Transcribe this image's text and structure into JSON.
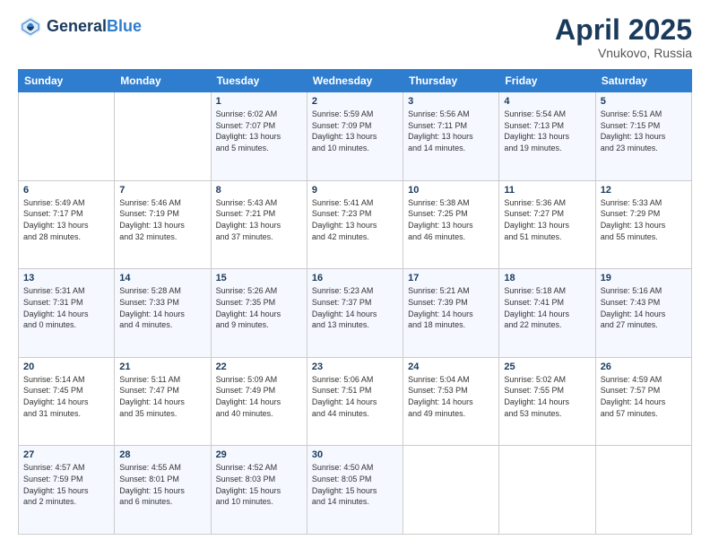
{
  "logo": {
    "line1": "General",
    "line2": "Blue"
  },
  "header": {
    "month": "April 2025",
    "location": "Vnukovo, Russia"
  },
  "weekdays": [
    "Sunday",
    "Monday",
    "Tuesday",
    "Wednesday",
    "Thursday",
    "Friday",
    "Saturday"
  ],
  "weeks": [
    [
      {
        "day": "",
        "info": ""
      },
      {
        "day": "",
        "info": ""
      },
      {
        "day": "1",
        "info": "Sunrise: 6:02 AM\nSunset: 7:07 PM\nDaylight: 13 hours\nand 5 minutes."
      },
      {
        "day": "2",
        "info": "Sunrise: 5:59 AM\nSunset: 7:09 PM\nDaylight: 13 hours\nand 10 minutes."
      },
      {
        "day": "3",
        "info": "Sunrise: 5:56 AM\nSunset: 7:11 PM\nDaylight: 13 hours\nand 14 minutes."
      },
      {
        "day": "4",
        "info": "Sunrise: 5:54 AM\nSunset: 7:13 PM\nDaylight: 13 hours\nand 19 minutes."
      },
      {
        "day": "5",
        "info": "Sunrise: 5:51 AM\nSunset: 7:15 PM\nDaylight: 13 hours\nand 23 minutes."
      }
    ],
    [
      {
        "day": "6",
        "info": "Sunrise: 5:49 AM\nSunset: 7:17 PM\nDaylight: 13 hours\nand 28 minutes."
      },
      {
        "day": "7",
        "info": "Sunrise: 5:46 AM\nSunset: 7:19 PM\nDaylight: 13 hours\nand 32 minutes."
      },
      {
        "day": "8",
        "info": "Sunrise: 5:43 AM\nSunset: 7:21 PM\nDaylight: 13 hours\nand 37 minutes."
      },
      {
        "day": "9",
        "info": "Sunrise: 5:41 AM\nSunset: 7:23 PM\nDaylight: 13 hours\nand 42 minutes."
      },
      {
        "day": "10",
        "info": "Sunrise: 5:38 AM\nSunset: 7:25 PM\nDaylight: 13 hours\nand 46 minutes."
      },
      {
        "day": "11",
        "info": "Sunrise: 5:36 AM\nSunset: 7:27 PM\nDaylight: 13 hours\nand 51 minutes."
      },
      {
        "day": "12",
        "info": "Sunrise: 5:33 AM\nSunset: 7:29 PM\nDaylight: 13 hours\nand 55 minutes."
      }
    ],
    [
      {
        "day": "13",
        "info": "Sunrise: 5:31 AM\nSunset: 7:31 PM\nDaylight: 14 hours\nand 0 minutes."
      },
      {
        "day": "14",
        "info": "Sunrise: 5:28 AM\nSunset: 7:33 PM\nDaylight: 14 hours\nand 4 minutes."
      },
      {
        "day": "15",
        "info": "Sunrise: 5:26 AM\nSunset: 7:35 PM\nDaylight: 14 hours\nand 9 minutes."
      },
      {
        "day": "16",
        "info": "Sunrise: 5:23 AM\nSunset: 7:37 PM\nDaylight: 14 hours\nand 13 minutes."
      },
      {
        "day": "17",
        "info": "Sunrise: 5:21 AM\nSunset: 7:39 PM\nDaylight: 14 hours\nand 18 minutes."
      },
      {
        "day": "18",
        "info": "Sunrise: 5:18 AM\nSunset: 7:41 PM\nDaylight: 14 hours\nand 22 minutes."
      },
      {
        "day": "19",
        "info": "Sunrise: 5:16 AM\nSunset: 7:43 PM\nDaylight: 14 hours\nand 27 minutes."
      }
    ],
    [
      {
        "day": "20",
        "info": "Sunrise: 5:14 AM\nSunset: 7:45 PM\nDaylight: 14 hours\nand 31 minutes."
      },
      {
        "day": "21",
        "info": "Sunrise: 5:11 AM\nSunset: 7:47 PM\nDaylight: 14 hours\nand 35 minutes."
      },
      {
        "day": "22",
        "info": "Sunrise: 5:09 AM\nSunset: 7:49 PM\nDaylight: 14 hours\nand 40 minutes."
      },
      {
        "day": "23",
        "info": "Sunrise: 5:06 AM\nSunset: 7:51 PM\nDaylight: 14 hours\nand 44 minutes."
      },
      {
        "day": "24",
        "info": "Sunrise: 5:04 AM\nSunset: 7:53 PM\nDaylight: 14 hours\nand 49 minutes."
      },
      {
        "day": "25",
        "info": "Sunrise: 5:02 AM\nSunset: 7:55 PM\nDaylight: 14 hours\nand 53 minutes."
      },
      {
        "day": "26",
        "info": "Sunrise: 4:59 AM\nSunset: 7:57 PM\nDaylight: 14 hours\nand 57 minutes."
      }
    ],
    [
      {
        "day": "27",
        "info": "Sunrise: 4:57 AM\nSunset: 7:59 PM\nDaylight: 15 hours\nand 2 minutes."
      },
      {
        "day": "28",
        "info": "Sunrise: 4:55 AM\nSunset: 8:01 PM\nDaylight: 15 hours\nand 6 minutes."
      },
      {
        "day": "29",
        "info": "Sunrise: 4:52 AM\nSunset: 8:03 PM\nDaylight: 15 hours\nand 10 minutes."
      },
      {
        "day": "30",
        "info": "Sunrise: 4:50 AM\nSunset: 8:05 PM\nDaylight: 15 hours\nand 14 minutes."
      },
      {
        "day": "",
        "info": ""
      },
      {
        "day": "",
        "info": ""
      },
      {
        "day": "",
        "info": ""
      }
    ]
  ]
}
